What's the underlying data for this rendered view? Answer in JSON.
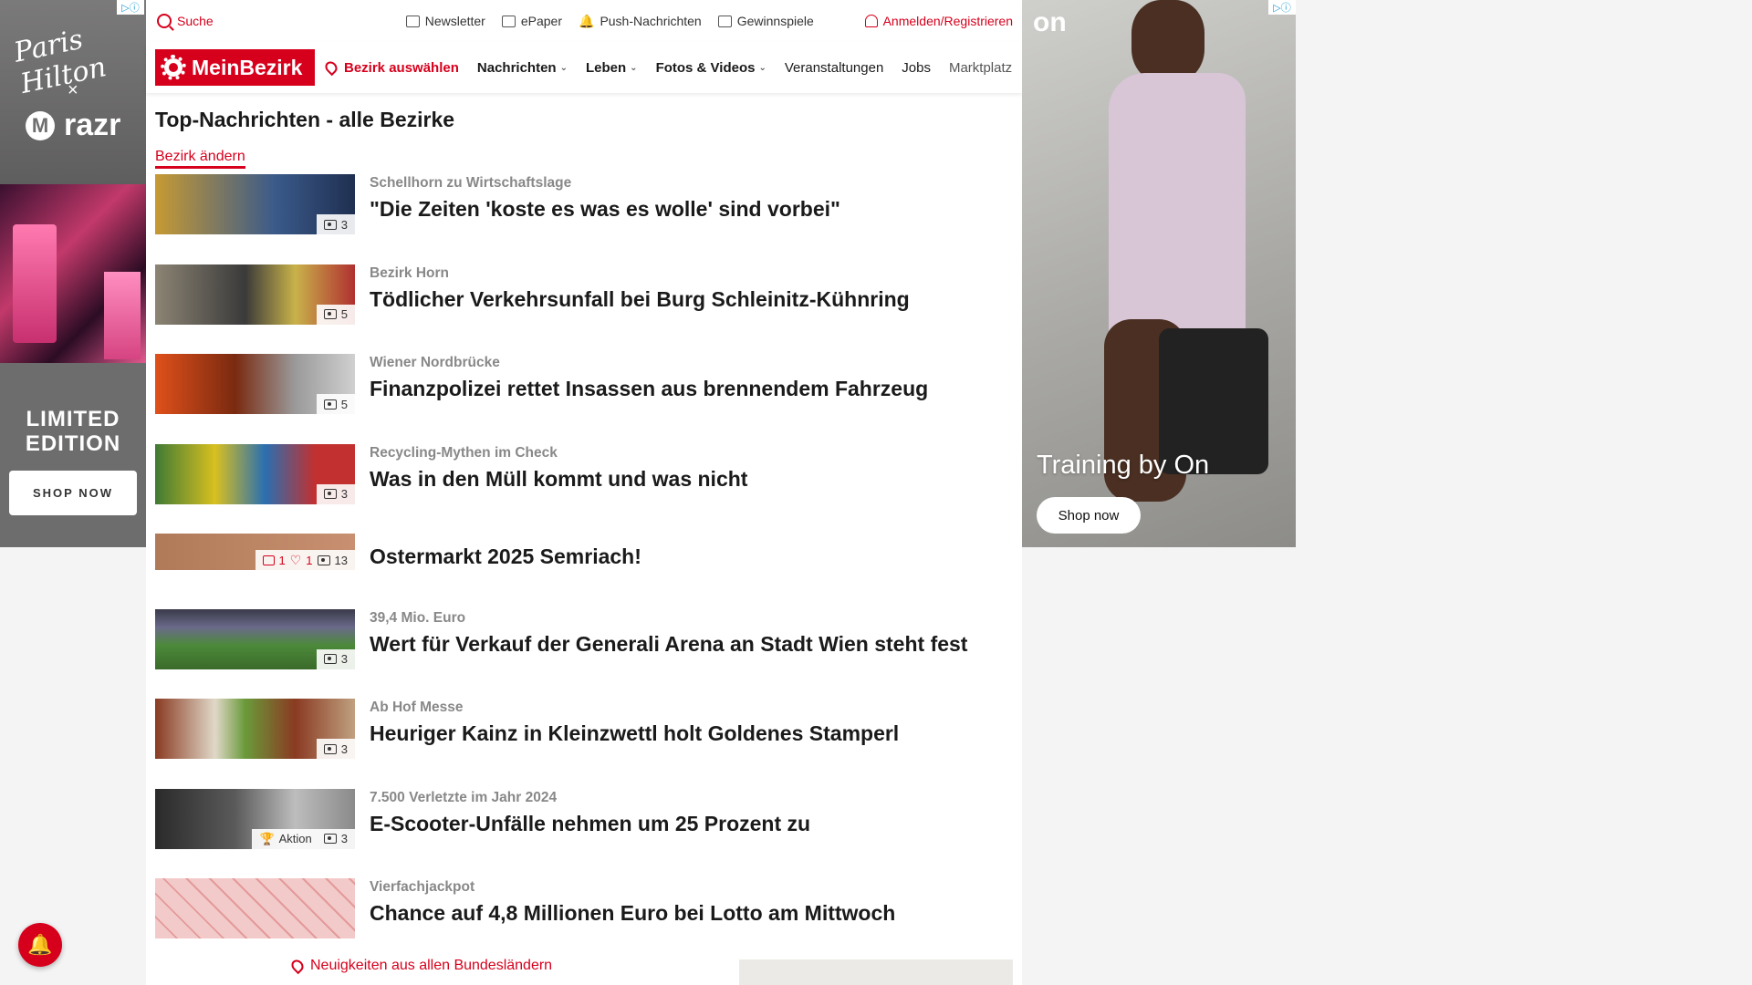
{
  "left_ad": {
    "brand1": "Paris Hilton",
    "separator": "×",
    "brand2": "razr",
    "headline": "LIMITED EDITION",
    "cta": "SHOP NOW"
  },
  "topbar": {
    "search": "Suche",
    "newsletter": "Newsletter",
    "epaper": "ePaper",
    "push": "Push-Nachrichten",
    "contests": "Gewinnspiele",
    "login": "Anmelden/Registrieren"
  },
  "navbar": {
    "logo": "MeinBezirk",
    "district_select": "Bezirk auswählen",
    "items": [
      "Nachrichten",
      "Leben",
      "Fotos & Videos",
      "Veranstaltungen",
      "Jobs",
      "Marktplatz"
    ]
  },
  "section": {
    "title": "Top-Nachrichten - alle Bezirke",
    "change_district": "Bezirk ändern"
  },
  "articles": [
    {
      "kicker": "Schellhorn zu Wirtschaftslage",
      "title": "\"Die Zeiten 'koste es was es wolle' sind vorbei\"",
      "photos": "3",
      "thumb_color": "#c79a33"
    },
    {
      "kicker": "Bezirk Horn",
      "title": "Tödlicher Verkehrsunfall bei Burg Schleinitz-Kühnring",
      "photos": "5",
      "thumb_color": "#6f6a60"
    },
    {
      "kicker": "Wiener Nordbrücke",
      "title": "Finanzpolizei rettet Insassen aus brennendem Fahrzeug",
      "photos": "5",
      "thumb_color": "#c2441c"
    },
    {
      "kicker": "Recycling-Mythen im Check",
      "title": "Was in den Müll kommt und was nicht",
      "photos": "3",
      "thumb_color": "#4f8a3a"
    },
    {
      "kicker": "",
      "title": "Ostermarkt 2025 Semriach!",
      "photos": "13",
      "comments": "1",
      "likes": "1",
      "thumb_color": "#a9704f"
    },
    {
      "kicker": "39,4 Mio. Euro",
      "title": "Wert für Verkauf der Generali Arena an Stadt Wien steht fest",
      "photos": "3",
      "thumb_color": "#4c7a3a"
    },
    {
      "kicker": "Ab Hof Messe",
      "title": "Heuriger Kainz in Kleinzwettl holt Goldenes Stamperl",
      "photos": "3",
      "thumb_color": "#8a3a22"
    },
    {
      "kicker": "7.500 Verletzte im Jahr 2024",
      "title": "E-Scooter-Unfälle nehmen um 25 Prozent zu",
      "photos": "3",
      "tag": "Aktion",
      "thumb_color": "#5a5a5a"
    },
    {
      "kicker": "Vierfachjackpot",
      "title": "Chance auf 4,8 Millionen Euro bei Lotto am Mittwoch",
      "photos": "",
      "thumb_color": "#e8b8b8"
    }
  ],
  "bottom": {
    "all_states_link": "Neuigkeiten aus allen Bundesländern"
  },
  "right_ad": {
    "logo": "on",
    "tagline": "Training by On",
    "cta": "Shop now"
  }
}
